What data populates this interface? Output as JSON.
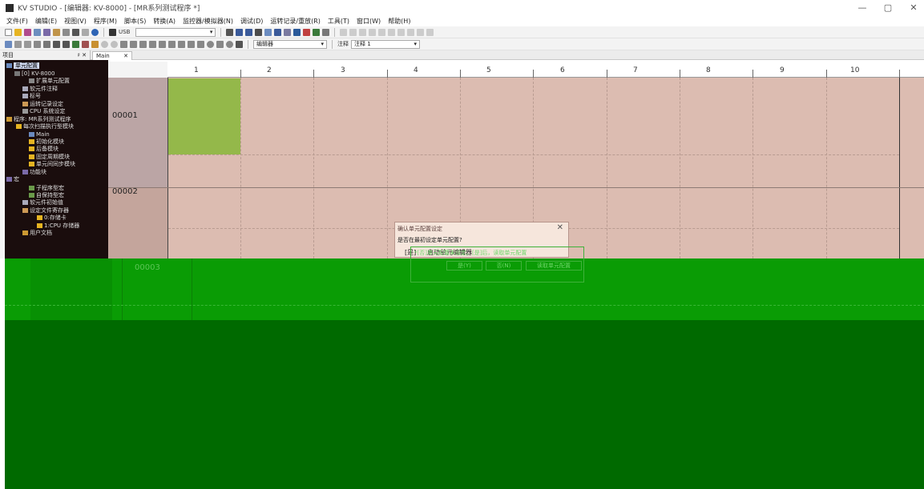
{
  "window": {
    "title": "KV STUDIO - [编辑器: KV-8000] - [MR系列测试程序 *]",
    "controls": [
      "—",
      "▢",
      "✕"
    ]
  },
  "menubar": {
    "items": [
      "文件(F)",
      "编辑(E)",
      "视图(V)",
      "程序(M)",
      "脚本(S)",
      "转换(A)",
      "监控器/模拟器(N)",
      "调试(D)",
      "运转记录/重放(R)",
      "工具(T)",
      "窗口(W)",
      "帮助(H)"
    ]
  },
  "toolbar1": {
    "connection": "USB"
  },
  "toolbar2": {
    "editor_mode": "编辑器",
    "comment_label": "注释",
    "comment_select": "注释 1"
  },
  "project_panel": {
    "title": "项目",
    "pin": "♯",
    "close": "✕"
  },
  "tabs": [
    {
      "label": "Main",
      "close": "✕"
    }
  ],
  "tree": {
    "items": [
      {
        "label": "单元配置",
        "level": 0
      },
      {
        "label": "[0] KV-8000",
        "level": 1
      },
      {
        "label": "扩展单元配置",
        "level": 2
      },
      {
        "label": "软元件注释",
        "level": 1
      },
      {
        "label": "标号",
        "level": 1
      },
      {
        "label": "运转记录设定",
        "level": 1
      },
      {
        "label": "CPU 系统设定",
        "level": 1
      },
      {
        "label": "程序: MR系列测试程序",
        "level": 0
      },
      {
        "label": "每次扫描执行型模块",
        "level": 1
      },
      {
        "label": "Main",
        "level": 2
      },
      {
        "label": "初始化模块",
        "level": 1
      },
      {
        "label": "后备模块",
        "level": 1
      },
      {
        "label": "固定周期模块",
        "level": 1
      },
      {
        "label": "单元间同步模块",
        "level": 1
      },
      {
        "label": "功能块",
        "level": 0
      },
      {
        "label": "宏",
        "level": 0
      },
      {
        "label": "子程序型宏",
        "level": 1
      },
      {
        "label": "自保持型宏",
        "level": 1
      },
      {
        "label": "软元件初始值",
        "level": 1
      },
      {
        "label": "设定文件寄存器",
        "level": 1
      },
      {
        "label": "0:存储卡",
        "level": 2
      },
      {
        "label": "1:CPU 存储器",
        "level": 2
      },
      {
        "label": "用户文档",
        "level": 0
      }
    ]
  },
  "ladder": {
    "columns": [
      "1",
      "2",
      "3",
      "4",
      "5",
      "6",
      "7",
      "8",
      "9",
      "10"
    ],
    "rows": [
      "00001",
      "00002",
      "00003"
    ]
  },
  "dialog": {
    "title": "确认单元配置设定",
    "message": "是否在最初设定单元配置?",
    "option": "[是]",
    "option_text": "启动单元编辑器",
    "sub_text": "*[否]单元配置未设定。[是]后，读取单元配置",
    "buttons": [
      "是(Y)",
      "否(N)",
      "读取单元配置"
    ],
    "close": "✕"
  },
  "colors": {
    "ladder_bg": "#dcbcb1",
    "selected_cell": "#94b84a",
    "green_band": "#0a9c05",
    "dark_green": "#006a00",
    "tree_bg": "#1a0d0d"
  }
}
